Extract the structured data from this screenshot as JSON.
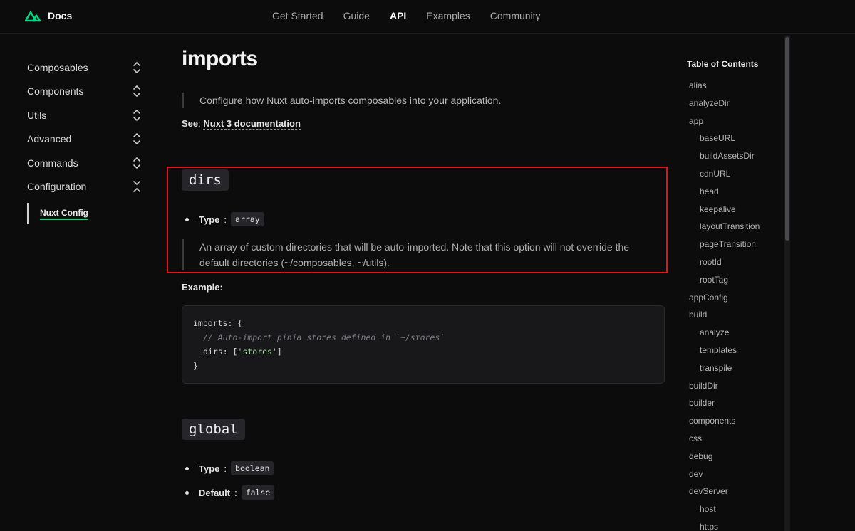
{
  "header": {
    "logo_text": "Docs",
    "nav": [
      {
        "label": "Get Started",
        "active": false
      },
      {
        "label": "Guide",
        "active": false
      },
      {
        "label": "API",
        "active": true
      },
      {
        "label": "Examples",
        "active": false
      },
      {
        "label": "Community",
        "active": false
      }
    ]
  },
  "sidebar": {
    "items": [
      {
        "label": "Composables",
        "expanded": false
      },
      {
        "label": "Components",
        "expanded": false
      },
      {
        "label": "Utils",
        "expanded": false
      },
      {
        "label": "Advanced",
        "expanded": false
      },
      {
        "label": "Commands",
        "expanded": false
      },
      {
        "label": "Configuration",
        "expanded": true
      }
    ],
    "sub_item": "Nuxt Config"
  },
  "main": {
    "title": "imports",
    "lead": "Configure how Nuxt auto-imports composables into your application.",
    "see_label": "See",
    "see_link": "Nuxt 3 documentation",
    "dirs": {
      "heading": "dirs",
      "type_label": "Type",
      "type_value": "array",
      "description": "An array of custom directories that will be auto-imported. Note that this option will not override the default directories (~/composables, ~/utils)."
    },
    "example_label": "Example",
    "code": {
      "line1": "imports: {",
      "line2": "// Auto-import pinia stores defined in `~/stores`",
      "line3_key": "dirs: [",
      "line3_str": "'stores'",
      "line3_end": "]",
      "line4": "}"
    },
    "global": {
      "heading": "global",
      "type_label": "Type",
      "type_value": "boolean",
      "default_label": "Default",
      "default_value": "false"
    }
  },
  "toc": {
    "title": "Table of Contents",
    "items": [
      {
        "label": "alias",
        "indent": false
      },
      {
        "label": "analyzeDir",
        "indent": false
      },
      {
        "label": "app",
        "indent": false
      },
      {
        "label": "baseURL",
        "indent": true
      },
      {
        "label": "buildAssetsDir",
        "indent": true
      },
      {
        "label": "cdnURL",
        "indent": true
      },
      {
        "label": "head",
        "indent": true
      },
      {
        "label": "keepalive",
        "indent": true
      },
      {
        "label": "layoutTransition",
        "indent": true
      },
      {
        "label": "pageTransition",
        "indent": true
      },
      {
        "label": "rootId",
        "indent": true
      },
      {
        "label": "rootTag",
        "indent": true
      },
      {
        "label": "appConfig",
        "indent": false
      },
      {
        "label": "build",
        "indent": false
      },
      {
        "label": "analyze",
        "indent": true
      },
      {
        "label": "templates",
        "indent": true
      },
      {
        "label": "transpile",
        "indent": true
      },
      {
        "label": "buildDir",
        "indent": false
      },
      {
        "label": "builder",
        "indent": false
      },
      {
        "label": "components",
        "indent": false
      },
      {
        "label": "css",
        "indent": false
      },
      {
        "label": "debug",
        "indent": false
      },
      {
        "label": "dev",
        "indent": false
      },
      {
        "label": "devServer",
        "indent": false
      },
      {
        "label": "host",
        "indent": true
      },
      {
        "label": "https",
        "indent": true
      }
    ]
  },
  "colors": {
    "accent": "#00dc82",
    "highlight": "#e0141a",
    "background": "#0c0c0d"
  }
}
